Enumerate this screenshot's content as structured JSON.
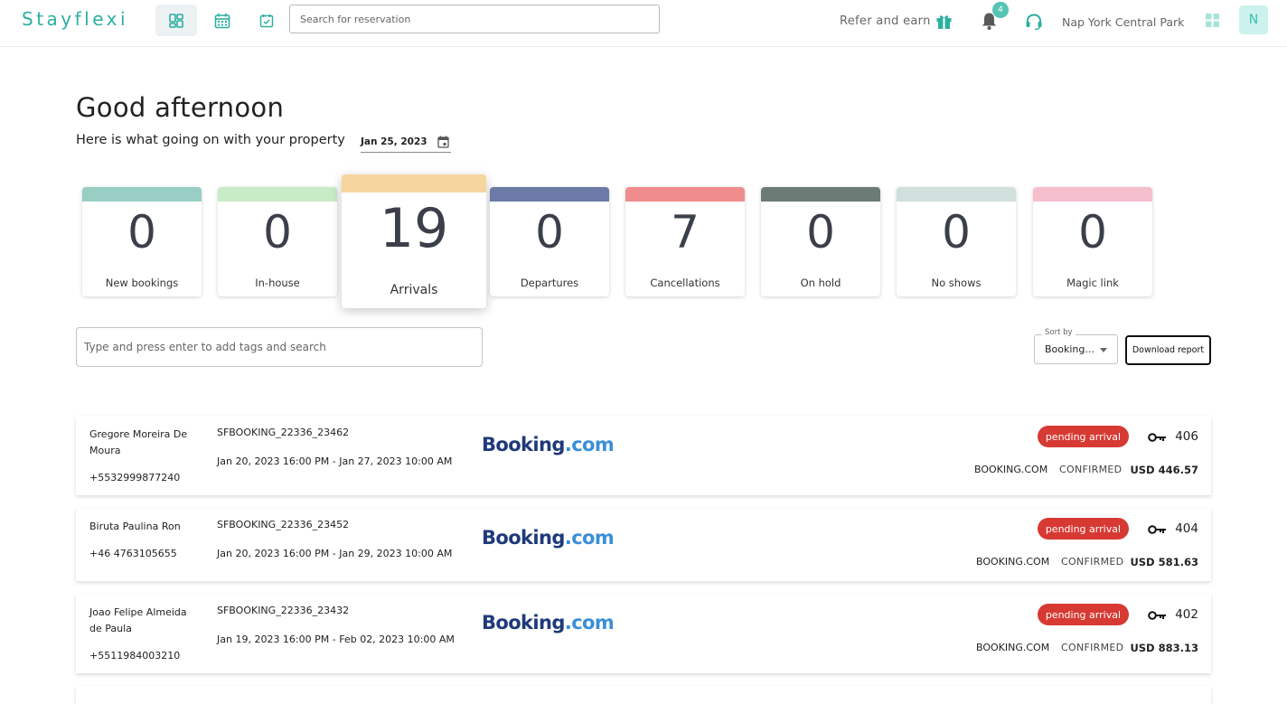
{
  "app": {
    "logo": "Stayflexi"
  },
  "header": {
    "search_placeholder": "Search for reservation",
    "refer_label": "Refer and earn",
    "notification_count": "4",
    "property_name": "Nap York Central Park",
    "avatar_initial": "N"
  },
  "colors": {
    "accent": "#2bb0a0",
    "status_pending": "#d73a33"
  },
  "main": {
    "greeting": "Good afternoon",
    "subtitle": "Here is what going on with your property",
    "date": "Jan 25, 2023"
  },
  "stats": [
    {
      "label": "New bookings",
      "value": "0",
      "color": "#98cec3"
    },
    {
      "label": "In-house",
      "value": "0",
      "color": "#c7ecc6"
    },
    {
      "label": "Arrivals",
      "value": "19",
      "color": "#f7d59e"
    },
    {
      "label": "Departures",
      "value": "0",
      "color": "#6b7aa6"
    },
    {
      "label": "Cancellations",
      "value": "7",
      "color": "#ee8d8c"
    },
    {
      "label": "On hold",
      "value": "0",
      "color": "#6c7b76"
    },
    {
      "label": "No shows",
      "value": "0",
      "color": "#d0e0dc"
    },
    {
      "label": "Magic link",
      "value": "0",
      "color": "#f6bfcd"
    }
  ],
  "filters": {
    "tag_placeholder": "Type and press enter to add tags and search",
    "sort_label": "Sort by",
    "sort_value": "Booking...",
    "download_label": "Download report"
  },
  "reservations": [
    {
      "name": "Gregore Moreira De Moura",
      "phone": "+5532999877240",
      "booking_id": "SFBOOKING_22336_23462",
      "dates": "Jan 20, 2023 16:00 PM - Jan 27, 2023 10:00 AM",
      "channel_logo_a": "Booking",
      "channel_logo_b": ".com",
      "status": "pending arrival",
      "room": "406",
      "source": "BOOKING.COM",
      "confirmation": "CONFIRMED",
      "amount": "USD 446.57"
    },
    {
      "name": "Biruta Paulina Ron",
      "phone": "+46 4763105655",
      "booking_id": "SFBOOKING_22336_23452",
      "dates": "Jan 20, 2023 16:00 PM - Jan 29, 2023 10:00 AM",
      "channel_logo_a": "Booking",
      "channel_logo_b": ".com",
      "status": "pending arrival",
      "room": "404",
      "source": "BOOKING.COM",
      "confirmation": "CONFIRMED",
      "amount": "USD 581.63"
    },
    {
      "name": "Joao Felipe Almeida de Paula",
      "phone": "+5511984003210",
      "booking_id": "SFBOOKING_22336_23432",
      "dates": "Jan 19, 2023 16:00 PM - Feb 02, 2023 10:00 AM",
      "channel_logo_a": "Booking",
      "channel_logo_b": ".com",
      "status": "pending arrival",
      "room": "402",
      "source": "BOOKING.COM",
      "confirmation": "CONFIRMED",
      "amount": "USD 883.13"
    }
  ]
}
